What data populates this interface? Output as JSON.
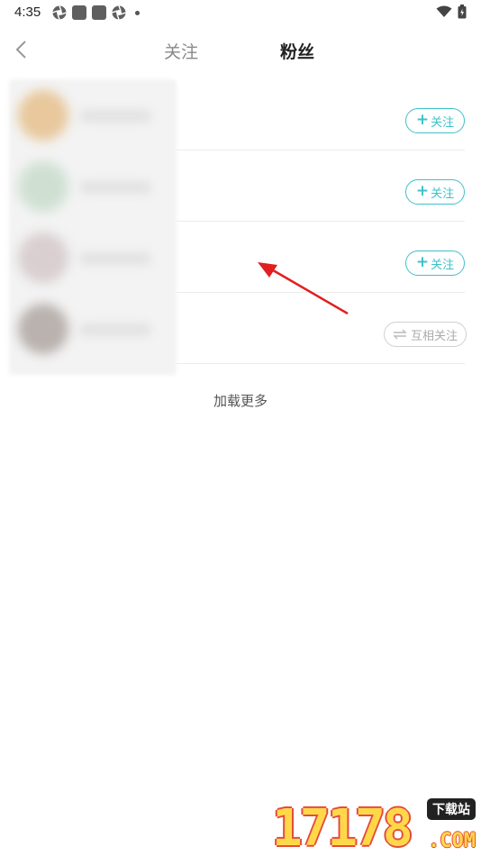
{
  "status_bar": {
    "time": "4:35",
    "left_icons": [
      "aperture-icon",
      "app-square-icon",
      "app-square-icon",
      "aperture-icon",
      "notification-dot-icon"
    ],
    "right_icons": [
      "wifi-icon",
      "battery-icon"
    ]
  },
  "header": {
    "back_icon": "back-chevron-icon",
    "tabs": [
      {
        "label": "关注",
        "active": false
      },
      {
        "label": "粉丝",
        "active": true
      }
    ]
  },
  "fans_list": {
    "rows": [
      {
        "button_label": "关注",
        "button_type": "follow",
        "button_icon": "plus-icon"
      },
      {
        "button_label": "关注",
        "button_type": "follow",
        "button_icon": "plus-icon"
      },
      {
        "button_label": "关注",
        "button_type": "follow",
        "button_icon": "plus-icon"
      },
      {
        "button_label": "互相关注",
        "button_type": "mutual",
        "button_icon": "swap-arrows-icon"
      }
    ],
    "load_more": "加载更多"
  },
  "annotation": {
    "icon": "red-arrow-icon",
    "color": "#e02020"
  },
  "watermark": {
    "main": "17178",
    "badge": "下载站",
    "suffix": ".COM"
  },
  "colors": {
    "accent": "#3fc1c9",
    "muted": "#aaaaaa",
    "active_tab": "#222222",
    "inactive_tab": "#888888"
  }
}
